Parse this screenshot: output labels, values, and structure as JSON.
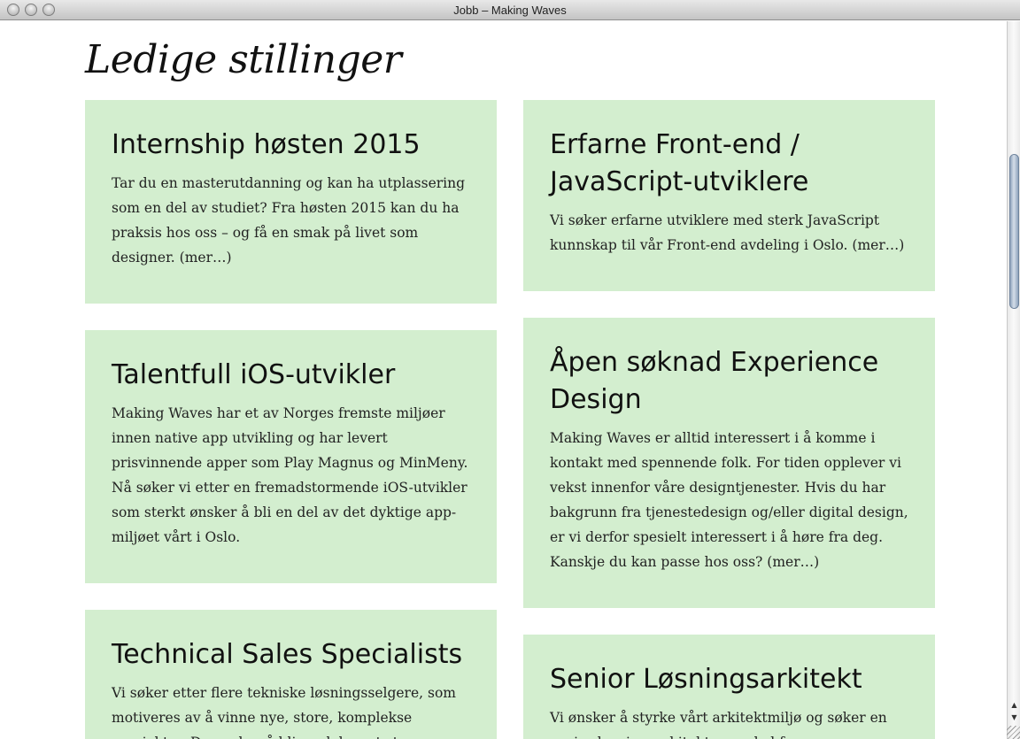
{
  "window": {
    "title": "Jobb – Making Waves"
  },
  "page": {
    "title": "Ledige stillinger"
  },
  "jobs": [
    {
      "title": "Internship høsten 2015",
      "text": "Tar du en masterutdanning og kan ha utplassering som en del av studiet? Fra høsten 2015 kan du ha praksis hos oss – og få en smak på livet som designer.",
      "more": "(mer…)"
    },
    {
      "title": "Erfarne Front-end / JavaScript-utviklere",
      "text": "Vi søker erfarne utviklere med sterk JavaScript kunnskap til vår Front-end avdeling i Oslo.",
      "more": "(mer…)"
    },
    {
      "title": "Talentfull iOS-utvikler",
      "text": "Making Waves har et av Norges fremste miljøer innen native app utvikling og har levert prisvinnende apper som Play Magnus og MinMeny. Nå søker vi etter en fremadstormende iOS-utvikler som sterkt ønsker å bli en del av det dyktige app-miljøet vårt i Oslo.",
      "more": ""
    },
    {
      "title": "Åpen søknad Experience Design",
      "text": "Making Waves er alltid interessert i å komme i kontakt med spennende folk. For tiden opplever vi vekst innenfor våre designtjenester. Hvis du har bakgrunn fra tjenestedesign og/eller digital design, er vi derfor spesielt interessert i å høre fra deg. Kanskje du kan passe hos oss?",
      "more": "(mer…)"
    },
    {
      "title": "Technical Sales Specialists",
      "text": "Vi søker etter flere tekniske løsningsselgere, som motiveres av å vinne nye, store, komplekse prosjekter. Du ønsker å bli en del av et større",
      "more": ""
    },
    {
      "title": "Senior Løsningsarkitekt",
      "text": "Vi ønsker å styrke vårt arkitektmiljø og søker en senior løsningsarkitekt som skal fungere som",
      "more": ""
    }
  ]
}
